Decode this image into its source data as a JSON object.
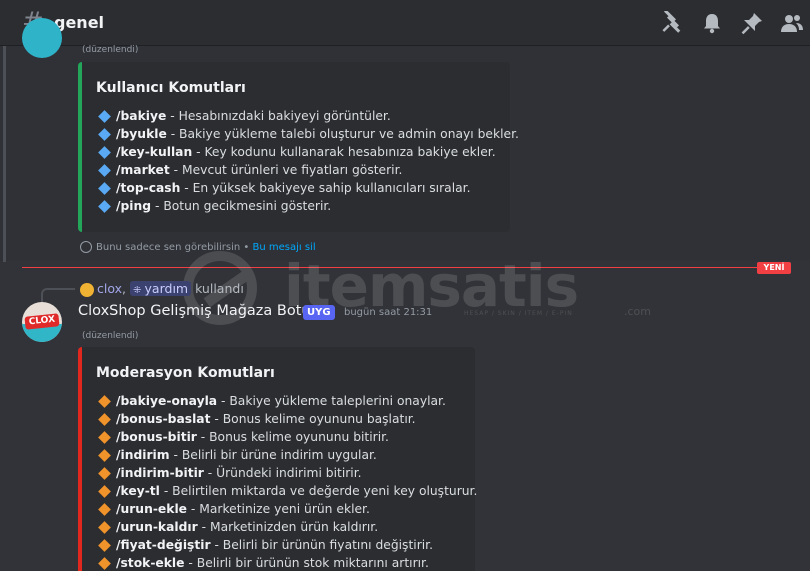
{
  "header": {
    "channel_name": "genel",
    "icons": [
      "threads-icon",
      "bell-icon",
      "pin-icon",
      "members-icon"
    ]
  },
  "message1": {
    "edited": "(düzenlendi)",
    "embed": {
      "color": "#23a55a",
      "title": "Kullanıcı Komutları",
      "items": [
        {
          "cmd": "/bakiye",
          "desc": " - Hesabınızdaki bakiyeyi görüntüler."
        },
        {
          "cmd": "/byukle",
          "desc": " - Bakiye yükleme talebi oluşturur ve admin onayı bekler."
        },
        {
          "cmd": "/key-kullan",
          "desc": " - Key kodunu kullanarak hesabınıza bakiye ekler."
        },
        {
          "cmd": "/market",
          "desc": " - Mevcut ürünleri ve fiyatları gösterir."
        },
        {
          "cmd": "/top-cash",
          "desc": " - En yüksek bakiyeye sahip kullanıcıları sıralar."
        },
        {
          "cmd": "/ping",
          "desc": " - Botun gecikmesini gösterir."
        }
      ]
    },
    "ephemeral_text": "Bunu sadece sen görebilirsin",
    "separator": " • ",
    "delete_link": "Bu mesajı sil"
  },
  "divider": {
    "new_label": "YENİ"
  },
  "message2": {
    "reply_user": "clox",
    "reply_sep": ", ",
    "reply_command": "yardım",
    "reply_used": "kullandı",
    "avatar_text": "CLOX",
    "author": "CloxShop Gelişmiş Mağaza Botu",
    "bot_tag": "UYG",
    "timestamp": "bugün saat 21:31",
    "edited": "(düzenlendi)",
    "embed": {
      "color": "#e0281e",
      "title": "Moderasyon Komutları",
      "items": [
        {
          "cmd": "/bakiye-onayla",
          "desc": " - Bakiye yükleme taleplerini onaylar."
        },
        {
          "cmd": "/bonus-baslat",
          "desc": " - Bonus kelime oyununu başlatır."
        },
        {
          "cmd": "/bonus-bitir",
          "desc": " - Bonus kelime oyununu bitirir."
        },
        {
          "cmd": "/indirim",
          "desc": " - Belirli bir ürüne indirim uygular."
        },
        {
          "cmd": "/indirim-bitir",
          "desc": " - Üründeki indirimi bitirir."
        },
        {
          "cmd": "/key-tl",
          "desc": " - Belirtilen miktarda ve değerde yeni key oluşturur."
        },
        {
          "cmd": "/urun-ekle",
          "desc": " - Marketinize yeni ürün ekler."
        },
        {
          "cmd": "/urun-kaldır",
          "desc": " - Marketinizden ürün kaldırır."
        },
        {
          "cmd": "/fiyat-değiştir",
          "desc": " - Belirli bir ürünün fiyatını değiştirir."
        },
        {
          "cmd": "/stok-ekle",
          "desc": " - Belirli bir ürünün stok miktarını artırır."
        }
      ]
    }
  },
  "watermark": {
    "text": "itemsatis",
    "sub": "HESAP / SKIN / ITEM / E-PIN",
    "domain": ".com"
  }
}
